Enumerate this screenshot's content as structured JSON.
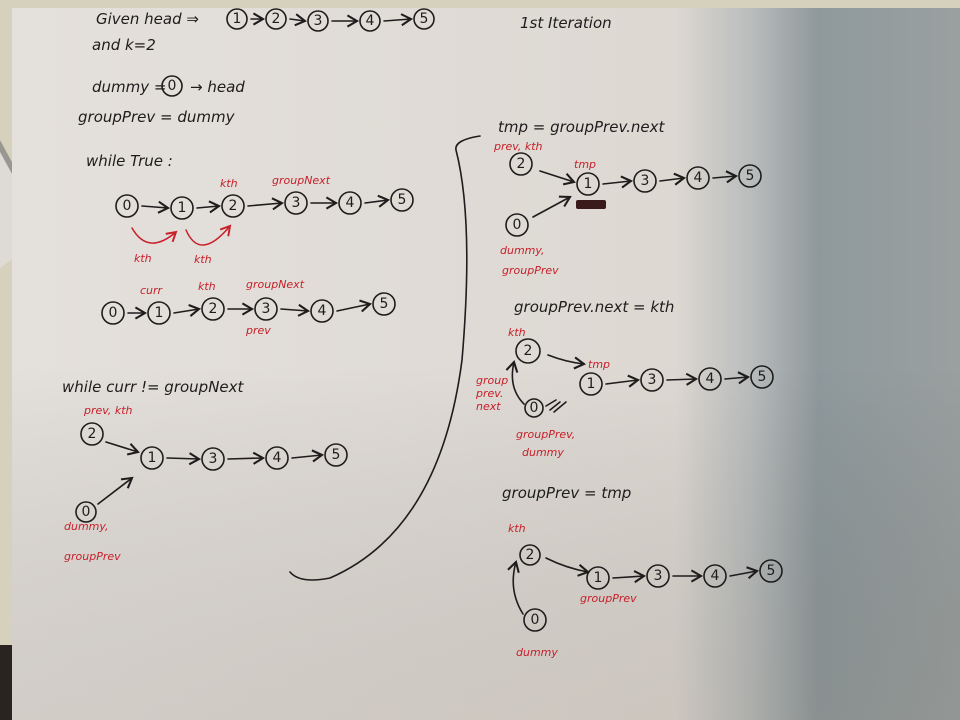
{
  "photo": {
    "subject": "handwritten notes on paper",
    "colors": {
      "paper": "#e2ddd6",
      "paper_shadow_right": "#8e979a",
      "background_desk": "#d6d1bd",
      "black_ink": "#1e1c1c",
      "red_ink": "#c8202a"
    }
  },
  "header": {
    "given_text": "Given head ⇒",
    "given_nodes": [
      "1",
      "2",
      "3",
      "4",
      "5"
    ],
    "k_text": "and k=2",
    "dummy_text_left": "dummy =",
    "dummy_node": "0",
    "dummy_text_right": "→ head",
    "groupprev_text": "groupPrev = dummy",
    "iteration_title": "1st Iteration"
  },
  "left": {
    "while_true": "while True :",
    "diagram1": {
      "nodes": [
        "0",
        "1",
        "2",
        "3",
        "4",
        "5"
      ],
      "labels": {
        "kth_above": "kth",
        "groupnext_above": "groupNext",
        "kth_below_1": "kth",
        "kth_below_2": "kth"
      }
    },
    "diagram2": {
      "nodes": [
        "0",
        "1",
        "2",
        "3",
        "4",
        "5"
      ],
      "labels": {
        "curr": "curr",
        "kth": "kth",
        "groupnext": "groupNext",
        "prev": "prev"
      }
    },
    "while_curr": "while curr != groupNext",
    "diagram3": {
      "nodes": [
        "2",
        "1",
        "3",
        "4",
        "5",
        "0"
      ],
      "labels": {
        "prev_kth": "prev, kth",
        "dummy": "dummy,",
        "groupprev": "groupPrev"
      }
    }
  },
  "right": {
    "step1": {
      "title": "tmp = groupPrev.next",
      "nodes": [
        "2",
        "1",
        "3",
        "4",
        "5",
        "0"
      ],
      "labels": {
        "prev_kth": "prev, kth",
        "tmp": "tmp",
        "dummy": "dummy,",
        "groupprev": "groupPrev"
      }
    },
    "step2": {
      "title": "groupPrev.next = kth",
      "nodes": [
        "2",
        "1",
        "3",
        "4",
        "5",
        "0"
      ],
      "labels": {
        "kth": "kth",
        "tmp": "tmp",
        "side_note_1": "group",
        "side_note_2": "prev.",
        "side_note_3": "next",
        "groupprev": "groupPrev,",
        "dummy": "dummy"
      }
    },
    "step3": {
      "title": "groupPrev = tmp",
      "nodes": [
        "2",
        "1",
        "3",
        "4",
        "5",
        "0"
      ],
      "labels": {
        "kth": "kth",
        "groupprev": "groupPrev",
        "dummy": "dummy"
      }
    }
  }
}
